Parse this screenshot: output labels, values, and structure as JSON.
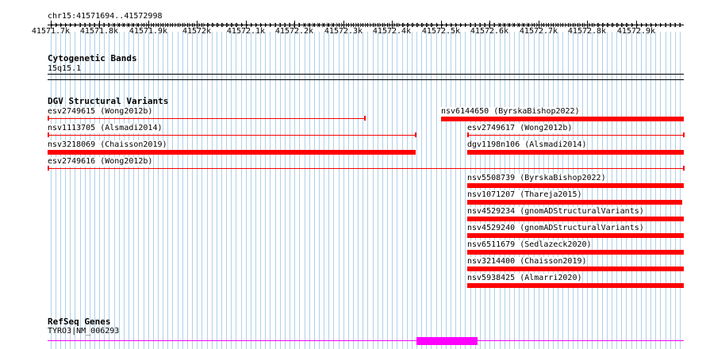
{
  "ruler": {
    "location": "chr15:41571694..41572998",
    "ticks": [
      "41571.7k",
      "41571.8k",
      "41571.9k",
      "41572k",
      "41572.1k",
      "41572.2k",
      "41572.3k",
      "41572.4k",
      "41572.5k",
      "41572.6k",
      "41572.7k",
      "41572.8k",
      "41572.9k"
    ]
  },
  "tracks": {
    "cytoband": {
      "title": "Cytogenetic Bands",
      "band": "15q15.1"
    },
    "dgv": {
      "title": "DGV Structural Variants",
      "features": [
        {
          "id": "esv2749615",
          "label": "esv2749615 (Wong2012b)",
          "start": 41571694,
          "end": 41572345,
          "style": "thin"
        },
        {
          "id": "nsv6144650",
          "label": "nsv6144650 (ByrskaBishop2022)",
          "start": 41572500,
          "end": 41572998,
          "style": "thick"
        },
        {
          "id": "nsv1113705",
          "label": "nsv1113705 (Alsmadi2014)",
          "start": 41571694,
          "end": 41572448,
          "style": "thin"
        },
        {
          "id": "esv2749617",
          "label": "esv2749617 (Wong2012b)",
          "start": 41572554,
          "end": 41572998,
          "style": "thin"
        },
        {
          "id": "nsv3218069",
          "label": "nsv3218069 (Chaisson2019)",
          "start": 41571694,
          "end": 41572448,
          "style": "thick"
        },
        {
          "id": "dgv1198n106",
          "label": "dgv1198n106 (Alsmadi2014)",
          "start": 41572554,
          "end": 41572998,
          "style": "thick"
        },
        {
          "id": "esv2749616",
          "label": "esv2749616 (Wong2012b)",
          "start": 41571694,
          "end": 41572998,
          "style": "thin"
        },
        {
          "id": "nsv5508739",
          "label": "nsv5508739 (ByrskaBishop2022)",
          "start": 41572554,
          "end": 41572998,
          "style": "thick"
        },
        {
          "id": "nsv1071207",
          "label": "nsv1071207 (Thareja2015)",
          "start": 41572554,
          "end": 41572995,
          "style": "thick"
        },
        {
          "id": "nsv4529234",
          "label": "nsv4529234 (gnomADStructuralVariants)",
          "start": 41572554,
          "end": 41572998,
          "style": "thick"
        },
        {
          "id": "nsv4529240",
          "label": "nsv4529240 (gnomADStructuralVariants)",
          "start": 41572554,
          "end": 41572998,
          "style": "thick"
        },
        {
          "id": "nsv6511679",
          "label": "nsv6511679 (Sedlazeck2020)",
          "start": 41572554,
          "end": 41572998,
          "style": "thick"
        },
        {
          "id": "nsv3214400",
          "label": "nsv3214400 (Chaisson2019)",
          "start": 41572554,
          "end": 41572998,
          "style": "thick"
        },
        {
          "id": "nsv5938425",
          "label": "nsv5938425 (Almarri2020)",
          "start": 41572554,
          "end": 41572998,
          "style": "thick"
        }
      ]
    },
    "refseq": {
      "title": "RefSeq Genes",
      "gene_label": "TYRO3|NM_006293"
    }
  },
  "colors": {
    "feature": "#ff0000",
    "gene": "#ff00ff",
    "grid": "#b0d0e8"
  }
}
